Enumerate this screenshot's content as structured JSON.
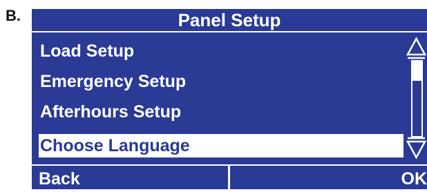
{
  "figure_label": "B.",
  "colors": {
    "panel": "#2a3a95",
    "highlight": "#ffffff",
    "text": "#ffffff"
  },
  "screen": {
    "title": "Panel Setup",
    "menu_items": [
      {
        "label": "Load Setup",
        "selected": false
      },
      {
        "label": "Emergency Setup",
        "selected": false
      },
      {
        "label": "Afterhours Setup",
        "selected": false
      },
      {
        "label": "Choose Language",
        "selected": true
      }
    ],
    "scrollbar": {
      "up_icon": "triangle-up-outline-icon",
      "down_icon": "triangle-down-outline-icon",
      "thumb_start_fraction": 0.25,
      "thumb_end_fraction": 1.0
    },
    "softkeys": {
      "back_label": "Back",
      "ok_label": "OK"
    }
  }
}
